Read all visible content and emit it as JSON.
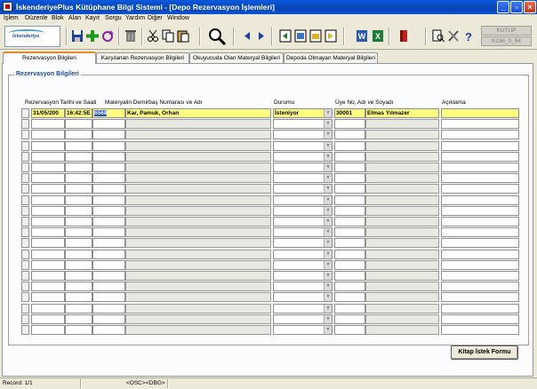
{
  "window": {
    "title": "İskenderiyePlus Kütüphane Bilgi Sistemi - [Depo Rezervasyon İşlemleri]"
  },
  "menu": [
    "İşlem",
    "Düzenle",
    "Blok",
    "Alan",
    "Kayıt",
    "Sorgu",
    "Yardım",
    "Diğer",
    "Window"
  ],
  "toolbar": {
    "logo_text": "İskenderiye",
    "status_top": "KUTUP",
    "status_bottom": "KGM_0_94"
  },
  "tabs": [
    {
      "label": "Rezervasyon Bilgileri",
      "active": true
    },
    {
      "label": "Karşılanan Rezervasyon Bilgileri",
      "active": false
    },
    {
      "label": "Okuyucuda Olan Materyal Bilgileri",
      "active": false
    },
    {
      "label": "Depoda Olmayan Materyal Bilgileri",
      "active": false
    }
  ],
  "group_title": "Rezervasyon Bilgileri",
  "columns": {
    "date": "Rezervasyon Tarihi ve Saati",
    "material": "Materyalin Demirbaş Numarası ve Adı",
    "status": "Durumu",
    "member": "Üye No, Adı ve Soyadı",
    "note": "Açıklama"
  },
  "first_row": {
    "date": "31/05/200",
    "time": "16:42:5E",
    "material_no": "6568",
    "material_name": "Kar, Pamuk, Orhan",
    "status": "İsteniyor",
    "member_no": "30001",
    "member_name": "Elmas Yılmazer",
    "note": ""
  },
  "buttons": {
    "request_form": "Kitap İstek Formu"
  },
  "statusbar": {
    "record": "Record: 1/1",
    "osc": "<OSC>",
    "dbg": "<DBG>"
  },
  "colors": {
    "title_bar": "#0842b0",
    "active_row": "#ffff80",
    "selection": "#1c4fd4",
    "tab_accent": "#e68b2c"
  }
}
